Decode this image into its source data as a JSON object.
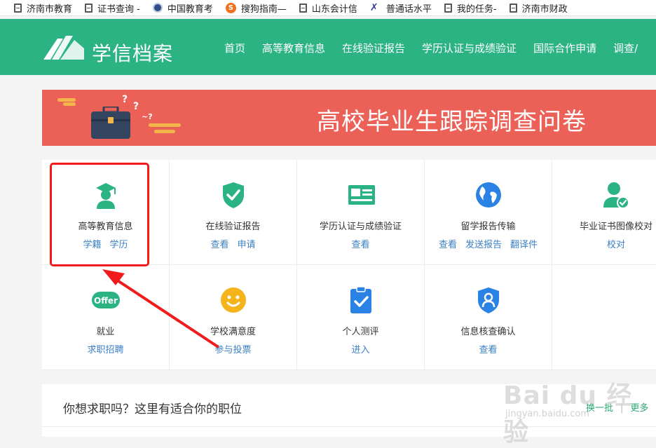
{
  "bookmarks": [
    {
      "label": "济南市教育",
      "icon": "document-icon"
    },
    {
      "label": "证书查询 -",
      "icon": "document-icon"
    },
    {
      "label": "中国教育考",
      "icon": "seal-icon"
    },
    {
      "label": "搜狗指南—",
      "icon": "sogou-icon"
    },
    {
      "label": "山东会计信",
      "icon": "document-icon"
    },
    {
      "label": "普通话水平",
      "icon": "x-logo-icon"
    },
    {
      "label": "我的任务-",
      "icon": "document-icon"
    },
    {
      "label": "济南市财政",
      "icon": "document-icon"
    }
  ],
  "header": {
    "title": "学信档案",
    "nav": [
      "首页",
      "高等教育信息",
      "在线验证报告",
      "学历认证与成绩验证",
      "国际合作申请",
      "调查/"
    ]
  },
  "banner": {
    "title": "高校毕业生跟踪调查问卷"
  },
  "services": [
    {
      "title": "高等教育信息",
      "links": [
        "学籍",
        "学历"
      ],
      "icon": "graduate-icon",
      "color": "#2cb383"
    },
    {
      "title": "在线验证报告",
      "links": [
        "查看",
        "申请"
      ],
      "icon": "shield-check-icon",
      "color": "#2cb383"
    },
    {
      "title": "学历认证与成绩验证",
      "links": [
        "查看"
      ],
      "icon": "id-card-icon",
      "color": "#2cb383"
    },
    {
      "title": "留学报告传输",
      "links": [
        "查看",
        "发送报告",
        "翻译件"
      ],
      "icon": "globe-icon",
      "color": "#2a82e4"
    },
    {
      "title": "毕业证书图像校对",
      "links": [
        "校对"
      ],
      "icon": "user-check-icon",
      "color": "#2cb383"
    },
    {
      "title": "就业",
      "links": [
        "求职招聘"
      ],
      "icon": "offer-icon",
      "icon_text": "Offer",
      "color": "#2cb383"
    },
    {
      "title": "学校满意度",
      "links": [
        "参与投票"
      ],
      "icon": "smile-icon",
      "color": "#f5b41c"
    },
    {
      "title": "个人测评",
      "links": [
        "进入"
      ],
      "icon": "clipboard-check-icon",
      "color": "#2a82e4"
    },
    {
      "title": "信息核查确认",
      "links": [
        "查看"
      ],
      "icon": "shield-user-icon",
      "color": "#2a82e4"
    }
  ],
  "jobs": {
    "title": "你想求职吗？这里有适合你的职位",
    "refresh": "换一批",
    "more": "更多"
  },
  "watermark": {
    "text": "Bai du 经验",
    "sub": "jingyan.baidu.com"
  },
  "colors": {
    "brand_green": "#2cb383",
    "banner_red": "#ec6157",
    "link_blue": "#3a7fc4",
    "annotation_red": "#f21a1a"
  }
}
